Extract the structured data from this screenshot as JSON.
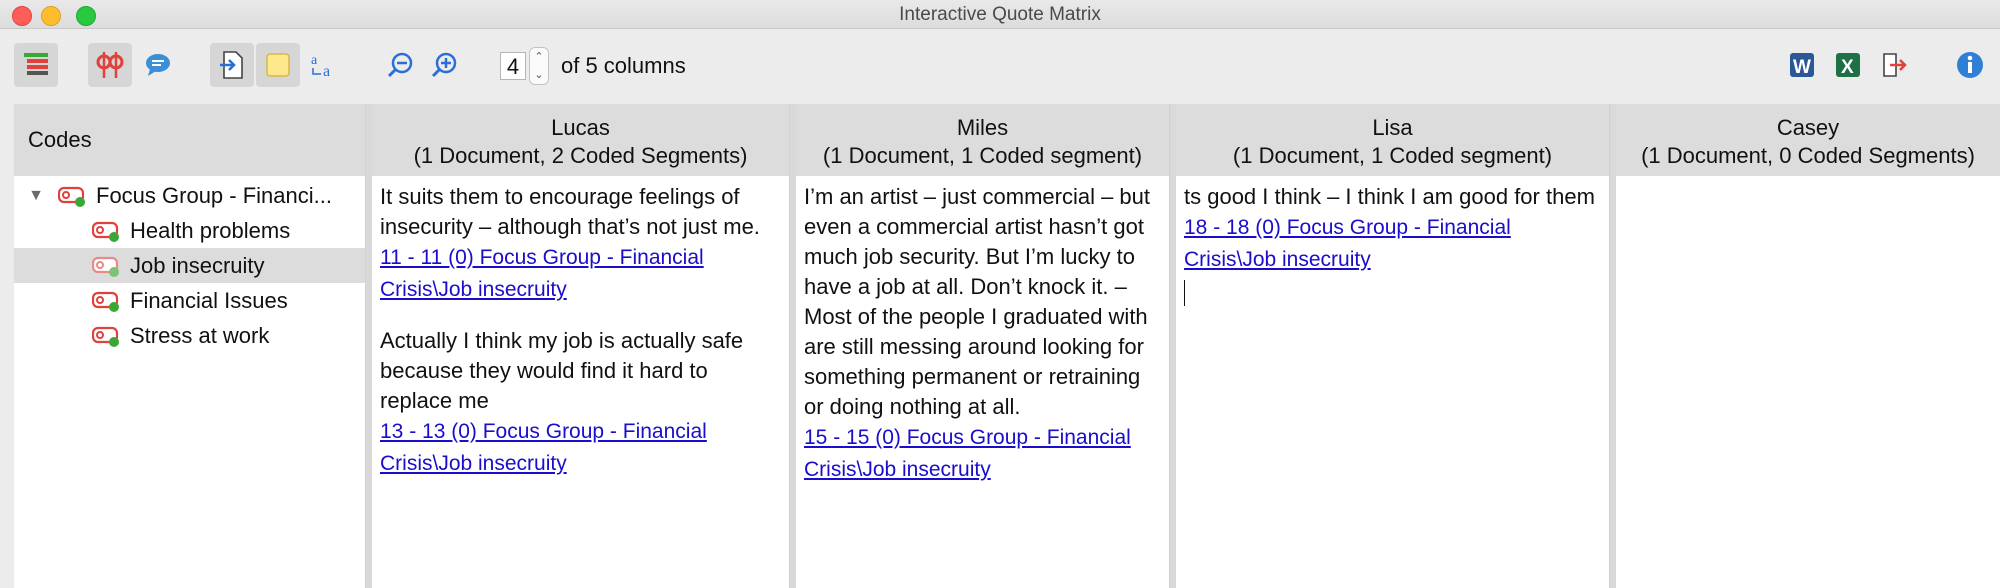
{
  "window": {
    "title": "Interactive Quote Matrix"
  },
  "toolbar": {
    "columns_value": "4",
    "columns_label": "of 5 columns",
    "icons": [
      "code-system-icon",
      "coded-segments-icon",
      "comments-icon",
      "import-icon",
      "memo-icon",
      "font-icon",
      "zoom-out-icon",
      "zoom-in-icon",
      "word-export-icon",
      "excel-export-icon",
      "export-icon",
      "info-icon"
    ]
  },
  "codes": {
    "header": "Codes",
    "items": [
      {
        "label": "Focus Group - Financi...",
        "level": 0,
        "expanded": true
      },
      {
        "label": "Health problems",
        "level": 1
      },
      {
        "label": "Job insecruity",
        "level": 1,
        "selected": true
      },
      {
        "label": "Financial Issues",
        "level": 1
      },
      {
        "label": "Stress at work",
        "level": 1
      }
    ]
  },
  "columns": [
    {
      "name": "Lucas",
      "summary": "(1 Document, 2 Coded Segments)",
      "segments": [
        {
          "text": "It suits them to encourage feelings of insecurity – although that’s not just me.",
          "link": "11 - 11  (0) Focus Group - Financial Crisis\\Job insecruity"
        },
        {
          "text": "Actually I think my job is actually safe because they would find it hard to replace me",
          "link": "13 - 13  (0) Focus Group - Financial Crisis\\Job insecruity"
        }
      ]
    },
    {
      "name": "Miles",
      "summary": "(1 Document, 1 Coded segment)",
      "segments": [
        {
          "text": "I’m an artist – just commercial – but even a commercial artist hasn’t got much job security. But I’m lucky to have a job at all. Don’t knock it. – Most of the people I graduated with are still messing around looking for something permanent or retraining or doing nothing at all.",
          "link": "15 - 15  (0) Focus Group - Financial Crisis\\Job insecruity"
        }
      ]
    },
    {
      "name": "Lisa",
      "summary": "(1 Document, 1 Coded segment)",
      "segments": [
        {
          "text": "ts good I think – I think I am good for them",
          "link": "18 - 18  (0) Focus Group - Financial Crisis\\Job insecruity"
        }
      ]
    },
    {
      "name": "Casey",
      "summary": "(1 Document, 0 Coded Segments)",
      "segments": []
    }
  ],
  "colors": {
    "link": "#1a0dcc",
    "code_icon": "#e0413a",
    "code_dot": "#3aa635",
    "header_bg": "#dcdcdc"
  }
}
